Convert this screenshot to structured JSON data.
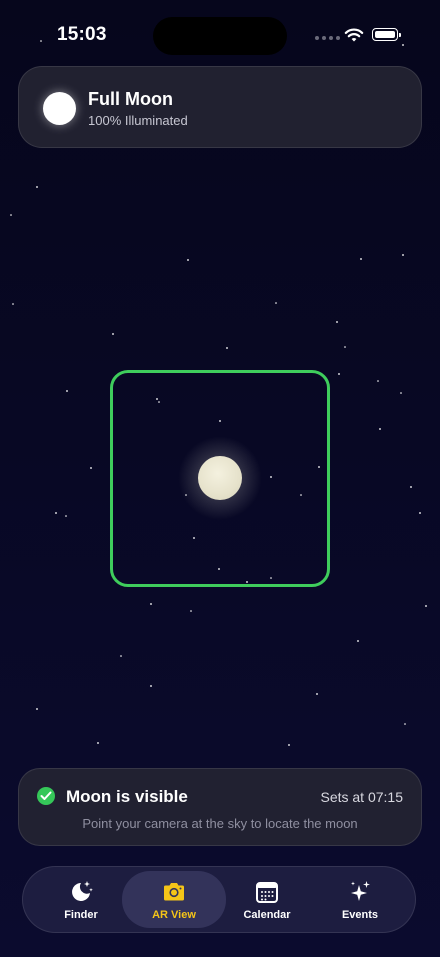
{
  "status_bar": {
    "time": "15:03"
  },
  "phase_card": {
    "title": "Full Moon",
    "subtitle": "100% Illuminated"
  },
  "visibility": {
    "title": "Moon is visible",
    "sets": "Sets at 07:15",
    "hint": "Point your camera at the sky to locate the moon"
  },
  "tabs": [
    {
      "label": "Finder",
      "icon": "moon-stars-icon",
      "active": false
    },
    {
      "label": "AR View",
      "icon": "camera-icon",
      "active": true
    },
    {
      "label": "Calendar",
      "icon": "calendar-icon",
      "active": false
    },
    {
      "label": "Events",
      "icon": "sparkles-icon",
      "active": false
    }
  ],
  "colors": {
    "accent": "#f5c518",
    "frame": "#3fcd5c",
    "success": "#35c759",
    "background": "#08081f"
  }
}
